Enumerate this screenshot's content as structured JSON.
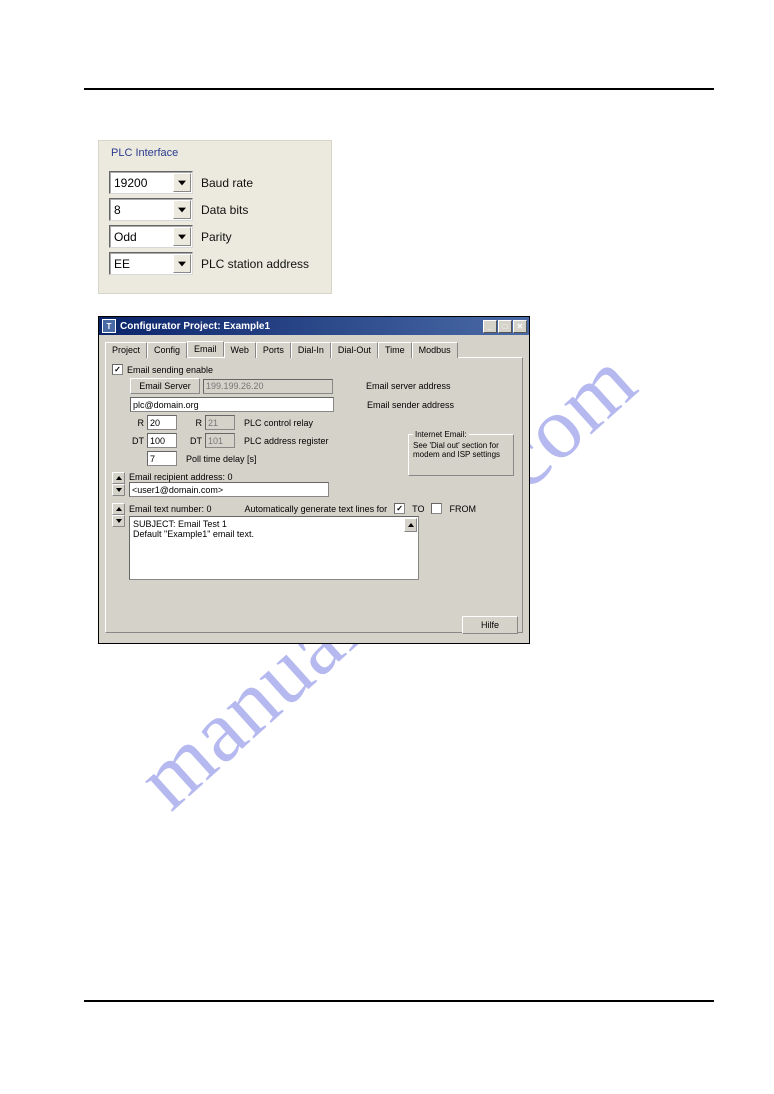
{
  "watermark": "manualshive.com",
  "plc_panel": {
    "legend": "PLC Interface",
    "rows": [
      {
        "value": "19200",
        "label": "Baud rate"
      },
      {
        "value": "8",
        "label": "Data bits"
      },
      {
        "value": "Odd",
        "label": "Parity"
      },
      {
        "value": "EE",
        "label": "PLC station address"
      }
    ]
  },
  "config": {
    "window_title": "Configurator Project: Example1",
    "tabs": [
      "Project",
      "Config",
      "Email",
      "Web",
      "Ports",
      "Dial-In",
      "Dial-Out",
      "Time",
      "Modbus"
    ],
    "active_tab": "Email",
    "enable_checkbox_label": "Email sending enable",
    "enable_checked": "✓",
    "email_server_btn": "Email Server",
    "email_server_ip": "199.199.26.20",
    "email_server_addr_label": "Email server address",
    "sender_value": "plc@domain.org",
    "sender_addr_label": "Email sender address",
    "r_label_1": "R",
    "r_value_1": "20",
    "r_label_2": "R",
    "r_value_2": "21",
    "control_relay_label": "PLC control relay",
    "dt_label_1": "DT",
    "dt_value_1": "100",
    "dt_label_2": "DT",
    "dt_value_2": "101",
    "address_register_label": "PLC address register",
    "poll_value": "7",
    "poll_label": "Poll time delay [s]",
    "internet_group_title": "Internet Email:",
    "internet_group_text": "See 'Dial out' section for modem and ISP settings",
    "recipient_label": "Email recipient address: 0",
    "recipient_value": "<user1@domain.com>",
    "text_number_label": "Email text number: 0",
    "autogen_label": "Automatically generate text lines for",
    "to_label": "TO",
    "to_checked": "✓",
    "from_label": "FROM",
    "email_text_line1": "SUBJECT: Email Test 1",
    "email_text_line2": "Default \"Example1\" email text.",
    "help_button": "Hilfe"
  }
}
